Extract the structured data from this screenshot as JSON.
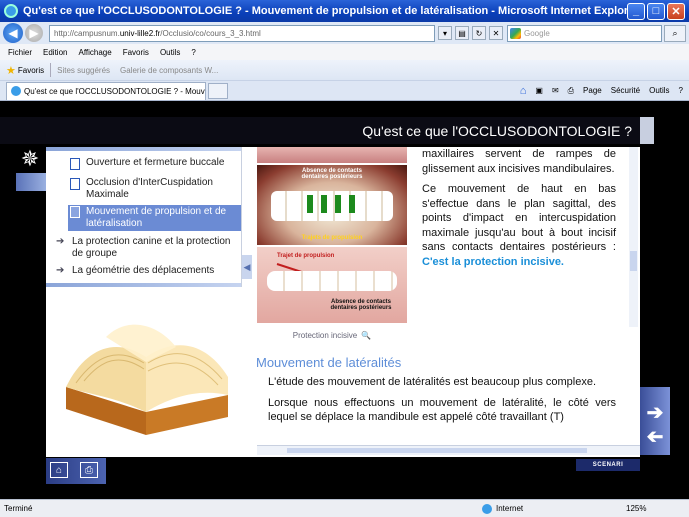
{
  "window": {
    "title": "Qu'est ce que l'OCCLUSODONTOLOGIE ? - Mouvement de propulsion et de latéralisation - Microsoft Internet Explorer"
  },
  "address": {
    "prefix": "http://campusnum.",
    "domain": "univ-lille2.fr",
    "suffix": "/Occlusio/co/cours_3_3.html"
  },
  "search": {
    "placeholder": "Google"
  },
  "menu": [
    "Fichier",
    "Edition",
    "Affichage",
    "Favoris",
    "Outils",
    "?"
  ],
  "favorites": {
    "label": "Favoris",
    "suggested": "Sites suggérés",
    "gallery": "Galerie de composants W..."
  },
  "tab": {
    "label": "Qu'est ce que l'OCCLUSODONTOLOGIE ? - Mouvemen..."
  },
  "toolbar": {
    "page": "Page",
    "security": "Sécurité",
    "tools": "Outils"
  },
  "page": {
    "header": "Qu'est ce que l'OCCLUSODONTOLOGIE ?",
    "outline": {
      "items": [
        {
          "label": "Ouverture et fermeture buccale"
        },
        {
          "label": "Occlusion d'InterCuspidation Maximale"
        },
        {
          "label": "Mouvement de propulsion et de latéralisation"
        }
      ],
      "subs": [
        {
          "label": "La protection canine et la protection de groupe"
        },
        {
          "label": "La géométrie des déplacements"
        }
      ]
    },
    "images": {
      "img2_top": "Absence de contacts dentaires postérieurs",
      "img2_bottom": "Trajets de propulsion",
      "img3_red": "Trajet de propulsion",
      "img3_black": "Absence de contacts dentaires postérieurs",
      "caption": "Protection incisive"
    },
    "text": {
      "p1": "maxillaires servent de rampes de glissement aux incisives mandibulaires.",
      "p2": "Ce mouvement de haut en bas s'effectue dans le plan sagittal, des points d'impact en intercuspidation maximale jusqu'au bout à bout incisif sans contacts dentaires postérieurs : ",
      "p2_highlight": "C'est la protection incisive.",
      "section": "Mouvement de latéralités",
      "p3": "L'étude des mouvement de latéralités est beaucoup plus complexe.",
      "p4": "Lorsque nous effectuons un mouvement de latéralité, le côté vers lequel se déplace la mandibule est appelé côté travaillant (T)"
    },
    "brand": "SCENARI"
  },
  "status": {
    "left": "Terminé",
    "zone": "Internet",
    "zoom": "125%"
  }
}
